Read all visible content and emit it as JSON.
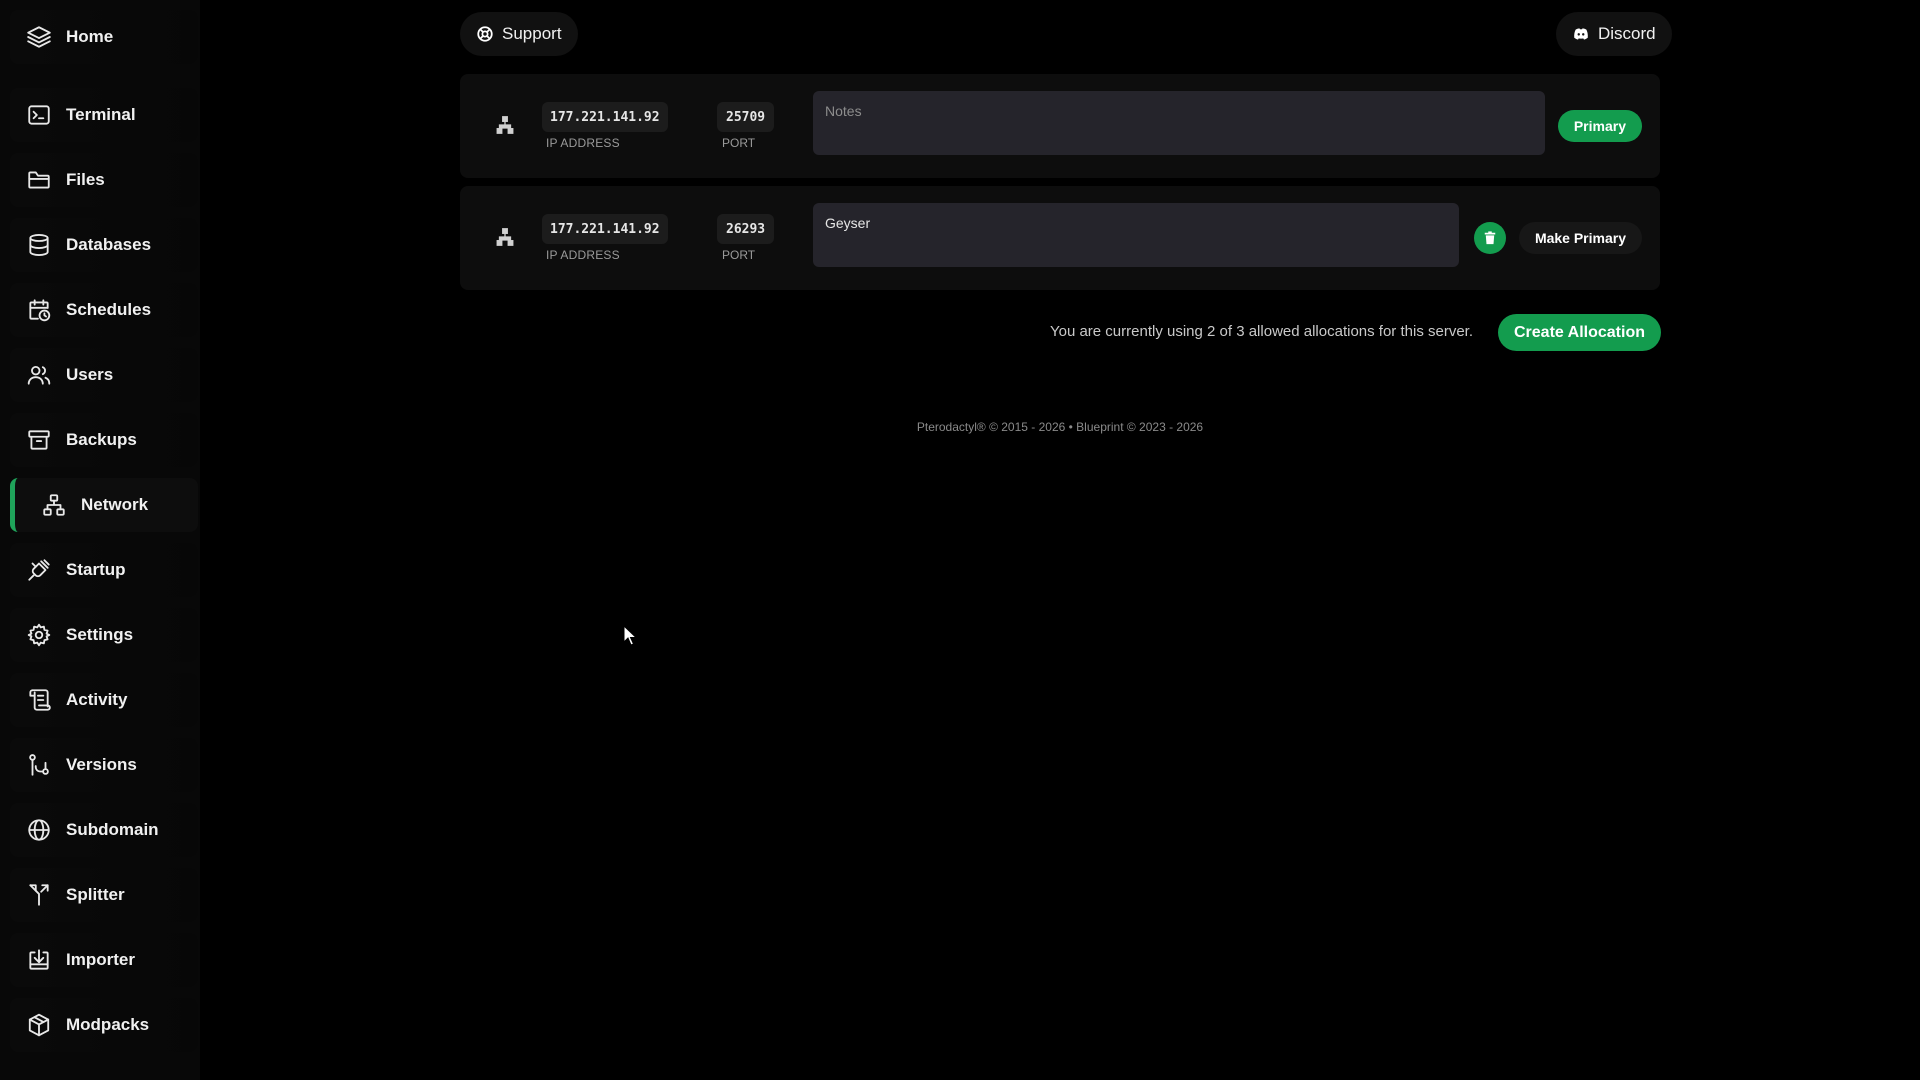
{
  "sidebar": {
    "items": [
      {
        "label": "Home",
        "icon": "layers-icon"
      },
      {
        "label": "Terminal",
        "icon": "terminal-icon"
      },
      {
        "label": "Files",
        "icon": "folder-icon"
      },
      {
        "label": "Databases",
        "icon": "database-icon"
      },
      {
        "label": "Schedules",
        "icon": "calendar-clock-icon"
      },
      {
        "label": "Users",
        "icon": "users-icon"
      },
      {
        "label": "Backups",
        "icon": "archive-icon"
      },
      {
        "label": "Network",
        "icon": "network-icon",
        "active": true
      },
      {
        "label": "Startup",
        "icon": "plug-icon"
      },
      {
        "label": "Settings",
        "icon": "gear-icon"
      },
      {
        "label": "Activity",
        "icon": "scroll-icon"
      },
      {
        "label": "Versions",
        "icon": "git-branch-icon"
      },
      {
        "label": "Subdomain",
        "icon": "globe-icon"
      },
      {
        "label": "Splitter",
        "icon": "split-icon"
      },
      {
        "label": "Importer",
        "icon": "import-icon"
      },
      {
        "label": "Modpacks",
        "icon": "package-icon"
      }
    ],
    "active_color": "#1fa35a"
  },
  "topbar": {
    "support_label": "Support",
    "discord_label": "Discord"
  },
  "allocations": [
    {
      "ip": "177.221.141.92",
      "ip_label": "IP ADDRESS",
      "port": "25709",
      "port_label": "PORT",
      "notes_value": "",
      "notes_placeholder": "Notes",
      "primary_label": "Primary"
    },
    {
      "ip": "177.221.141.92",
      "ip_label": "IP ADDRESS",
      "port": "26293",
      "port_label": "PORT",
      "notes_value": "Geyser",
      "notes_placeholder": "Notes",
      "make_primary_label": "Make Primary"
    }
  ],
  "allocation_info": "You are currently using 2 of 3 allowed allocations for this server.",
  "create_allocation_label": "Create Allocation",
  "footer": "Pterodactyl® © 2015 - 2026  •  Blueprint © 2023 - 2026",
  "colors": {
    "accent": "#139c4e",
    "background": "#000000",
    "panel": "#0d0d0d",
    "input": "#25242b"
  }
}
